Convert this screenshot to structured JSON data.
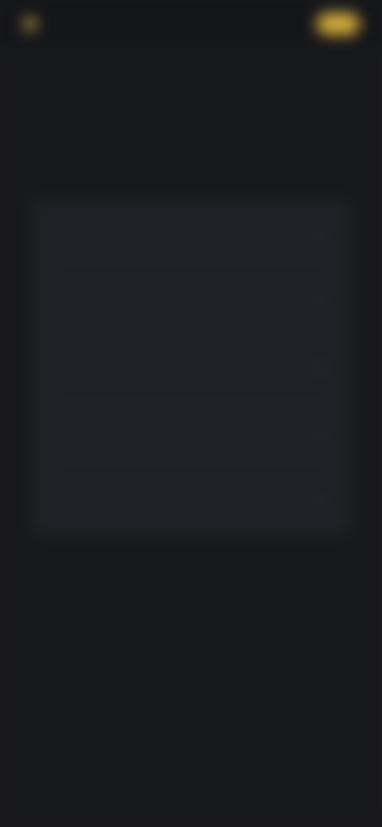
{
  "header": {
    "logo_text": "",
    "nav_link": "",
    "cta_label": ""
  },
  "hero": {
    "title": "",
    "subtitle": "",
    "accent_text": ""
  },
  "list": {
    "items": [
      {
        "label": ""
      },
      {
        "label": ""
      },
      {
        "label": ""
      },
      {
        "label": ""
      },
      {
        "label": ""
      }
    ]
  },
  "colors": {
    "accent": "#d6ad3c",
    "background": "#18191d",
    "card": "#202126"
  }
}
